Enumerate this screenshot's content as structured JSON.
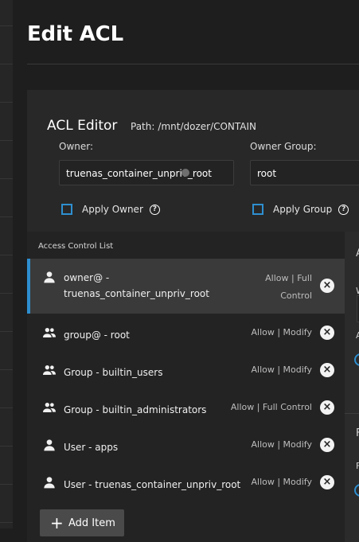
{
  "page": {
    "title": "Edit ACL"
  },
  "editor": {
    "title": "ACL Editor",
    "path_label": "Path:",
    "path_value": "/mnt/dozer/CONTAIN",
    "owner_label": "Owner:",
    "owner_value": "truenas_container_unpriv_root",
    "owner_group_label": "Owner Group:",
    "owner_group_value": "root",
    "apply_owner_label": "Apply Owner",
    "apply_group_label": "Apply Group",
    "help_glyph": "?"
  },
  "acl_list": {
    "header": "Access Control List",
    "items": [
      {
        "icon": "person-icon",
        "label_line1": "owner@ -",
        "label_line2": "truenas_container_unpriv_root",
        "perm_line1": "Allow | Full",
        "perm_line2": "Control",
        "selected": true
      },
      {
        "icon": "group-icon",
        "label_line1": "group@ - root",
        "perm_line1": "Allow | Modify"
      },
      {
        "icon": "group-icon",
        "label_line1": "Group - builtin_users",
        "perm_line1": "Allow | Modify"
      },
      {
        "icon": "group-icon",
        "label_line1": "Group - builtin_administrators",
        "perm_line1": "Allow | Full Control"
      },
      {
        "icon": "person-icon",
        "label_line1": "User - apps",
        "perm_line1": "Allow | Modify"
      },
      {
        "icon": "person-icon",
        "label_line1": "User - truenas_container_unpriv_root",
        "perm_line1": "Allow | Modify"
      }
    ],
    "remove_glyph": "×",
    "add_label": "Add Item",
    "add_glyph": "+"
  },
  "right_panel": {
    "letters": [
      "A",
      "W",
      "A",
      "F",
      "F"
    ]
  },
  "colors": {
    "accent": "#2e8fd0",
    "background": "#1e1e1e",
    "card": "#282828",
    "list": "#232323",
    "selected_row": "#3a3a3a"
  }
}
